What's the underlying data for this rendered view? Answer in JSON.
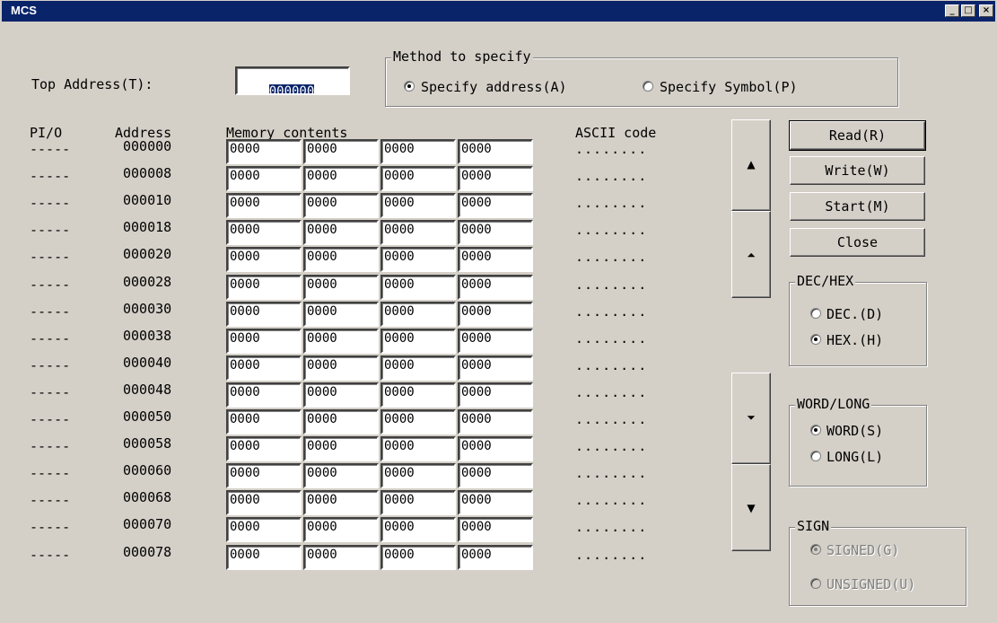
{
  "window": {
    "title": "MCS",
    "minimize_glyph": "_",
    "maximize_glyph": "□",
    "close_glyph": "×"
  },
  "top_address": {
    "label": "Top Address(T):",
    "value": "000000"
  },
  "method_group": {
    "title": "Method to specify",
    "options": [
      {
        "label": "Specify address(A)",
        "selected": true
      },
      {
        "label": "Specify Symbol(P)",
        "selected": false
      }
    ]
  },
  "table": {
    "headers": {
      "pio": "PI/O",
      "address": "Address",
      "memory": "Memory contents",
      "ascii": "ASCII code"
    },
    "rows": [
      {
        "pio": "-----",
        "address": "000000",
        "values": [
          "0000",
          "0000",
          "0000",
          "0000"
        ],
        "ascii": "........"
      },
      {
        "pio": "-----",
        "address": "000008",
        "values": [
          "0000",
          "0000",
          "0000",
          "0000"
        ],
        "ascii": "........"
      },
      {
        "pio": "-----",
        "address": "000010",
        "values": [
          "0000",
          "0000",
          "0000",
          "0000"
        ],
        "ascii": "........"
      },
      {
        "pio": "-----",
        "address": "000018",
        "values": [
          "0000",
          "0000",
          "0000",
          "0000"
        ],
        "ascii": "........"
      },
      {
        "pio": "-----",
        "address": "000020",
        "values": [
          "0000",
          "0000",
          "0000",
          "0000"
        ],
        "ascii": "........"
      },
      {
        "pio": "-----",
        "address": "000028",
        "values": [
          "0000",
          "0000",
          "0000",
          "0000"
        ],
        "ascii": "........"
      },
      {
        "pio": "-----",
        "address": "000030",
        "values": [
          "0000",
          "0000",
          "0000",
          "0000"
        ],
        "ascii": "........"
      },
      {
        "pio": "-----",
        "address": "000038",
        "values": [
          "0000",
          "0000",
          "0000",
          "0000"
        ],
        "ascii": "........"
      },
      {
        "pio": "-----",
        "address": "000040",
        "values": [
          "0000",
          "0000",
          "0000",
          "0000"
        ],
        "ascii": "........"
      },
      {
        "pio": "-----",
        "address": "000048",
        "values": [
          "0000",
          "0000",
          "0000",
          "0000"
        ],
        "ascii": "........"
      },
      {
        "pio": "-----",
        "address": "000050",
        "values": [
          "0000",
          "0000",
          "0000",
          "0000"
        ],
        "ascii": "........"
      },
      {
        "pio": "-----",
        "address": "000058",
        "values": [
          "0000",
          "0000",
          "0000",
          "0000"
        ],
        "ascii": "........"
      },
      {
        "pio": "-----",
        "address": "000060",
        "values": [
          "0000",
          "0000",
          "0000",
          "0000"
        ],
        "ascii": "........"
      },
      {
        "pio": "-----",
        "address": "000068",
        "values": [
          "0000",
          "0000",
          "0000",
          "0000"
        ],
        "ascii": "........"
      },
      {
        "pio": "-----",
        "address": "000070",
        "values": [
          "0000",
          "0000",
          "0000",
          "0000"
        ],
        "ascii": "........"
      },
      {
        "pio": "-----",
        "address": "000078",
        "values": [
          "0000",
          "0000",
          "0000",
          "0000"
        ],
        "ascii": "........"
      }
    ]
  },
  "scroll_buttons": {
    "line_up": "▲",
    "page_up": "⏶",
    "page_down": "⏷",
    "line_down": "▼"
  },
  "buttons": {
    "read": "Read(R)",
    "write": "Write(W)",
    "start": "Start(M)",
    "close": "Close"
  },
  "dec_hex": {
    "title": "DEC/HEX",
    "options": [
      {
        "label": "DEC.(D)",
        "selected": false
      },
      {
        "label": "HEX.(H)",
        "selected": true
      }
    ]
  },
  "word_long": {
    "title": "WORD/LONG",
    "options": [
      {
        "label": "WORD(S)",
        "selected": true
      },
      {
        "label": "LONG(L)",
        "selected": false
      }
    ]
  },
  "sign": {
    "title": "SIGN",
    "disabled": true,
    "options": [
      {
        "label": "SIGNED(G)",
        "selected": true
      },
      {
        "label": "UNSIGNED(U)",
        "selected": false
      }
    ]
  }
}
